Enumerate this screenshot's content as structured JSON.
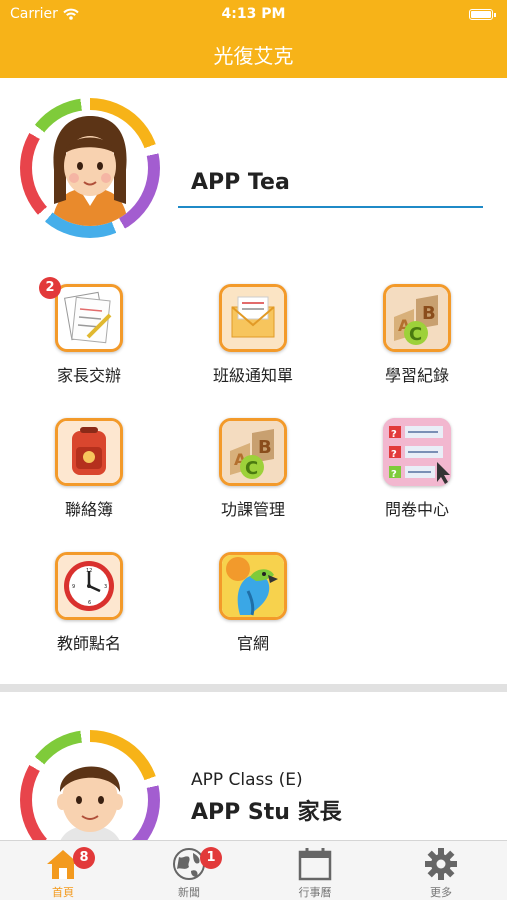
{
  "status_bar": {
    "carrier": "Carrier",
    "time": "4:13 PM"
  },
  "nav": {
    "title": "光復艾克"
  },
  "teacher": {
    "name": "APP Tea"
  },
  "menu": [
    {
      "label": "家長交辦",
      "badge": "2",
      "icon": "notebook-icon"
    },
    {
      "label": "班級通知單",
      "icon": "envelope-icon"
    },
    {
      "label": "學習紀錄",
      "icon": "abc-blocks-icon"
    },
    {
      "label": "聯絡簿",
      "icon": "schoolbag-icon"
    },
    {
      "label": "功課管理",
      "icon": "abc-blocks-icon"
    },
    {
      "label": "問卷中心",
      "icon": "questionnaire-icon"
    },
    {
      "label": "教師點名",
      "icon": "clock-icon"
    },
    {
      "label": "官網",
      "icon": "parrot-icon"
    }
  ],
  "student": {
    "class_line": "APP Class (E)",
    "name": "APP Stu 家長"
  },
  "tabs": [
    {
      "label": "首頁",
      "badge": "8",
      "icon": "home-icon",
      "active": true
    },
    {
      "label": "新聞",
      "badge": "1",
      "icon": "globe-icon",
      "active": false
    },
    {
      "label": "行事曆",
      "icon": "calendar-icon",
      "active": false
    },
    {
      "label": "更多",
      "icon": "gear-icon",
      "active": false
    }
  ],
  "colors": {
    "brand": "#f7b318",
    "badge": "#e2393a",
    "underline": "#1f8ac7",
    "active_tab": "#f39a1e"
  }
}
